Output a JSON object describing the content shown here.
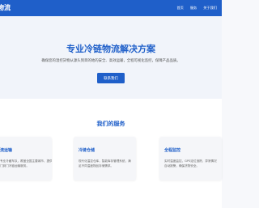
{
  "navbar": {
    "brand": "物流",
    "links": [
      "首页",
      "服务",
      "关于我们"
    ]
  },
  "hero": {
    "title": "专业冷链物流解决方案",
    "subtitle": "确保您的温控货物从源头到目的地的安全、高效运输，全程可视化监控，保障产品品质。",
    "button_label": "联系我们"
  },
  "services": {
    "title": "我们的服务",
    "cards": [
      {
        "title": "流运输",
        "desc": "专业冷藏车队，覆盖全国主要城市，提供门到门冷链运输服务。"
      },
      {
        "title": "冷链仓储",
        "desc": "现代化温控仓库，智能库存管理系统，满足不同温度物品存储需求。"
      },
      {
        "title": "全程监控",
        "desc": "实时温度监控，GPS定位追踪，异常情况自动报警，确保货物安全。"
      }
    ]
  },
  "colors": {
    "brand": "#1f5fc9",
    "background": "#f7f8fb"
  }
}
